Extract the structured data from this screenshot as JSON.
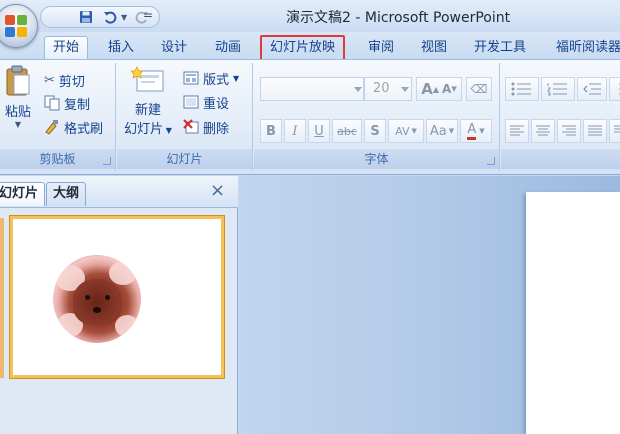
{
  "app": {
    "title": "演示文稿2 - Microsoft PowerPoint",
    "quick_access": {
      "save_icon": "save-icon",
      "undo_icon": "undo-icon",
      "redo_icon": "redo-icon",
      "customize_glyph": "="
    }
  },
  "tabs": [
    {
      "label": "开始",
      "active": true
    },
    {
      "label": "插入"
    },
    {
      "label": "设计"
    },
    {
      "label": "动画"
    },
    {
      "label": "幻灯片放映",
      "highlighted": true
    },
    {
      "label": "审阅"
    },
    {
      "label": "视图"
    },
    {
      "label": "开发工具"
    },
    {
      "label": "福昕阅读器"
    }
  ],
  "ribbon": {
    "clipboard": {
      "label": "剪贴板",
      "paste": "粘贴",
      "cut": "剪切",
      "copy": "复制",
      "format_painter": "格式刷"
    },
    "slides": {
      "label": "幻灯片",
      "new_slide_line1": "新建",
      "new_slide_line2": "幻灯片",
      "layout": "版式",
      "reset": "重设",
      "delete": "删除"
    },
    "font": {
      "label": "字体",
      "font_name": "",
      "font_size": "20",
      "bold": "B",
      "italic": "I",
      "underline": "U",
      "strike": "abc",
      "shadow": "S",
      "spacing": "AV",
      "change_case": "Aa",
      "font_color": "A",
      "grow": "A",
      "shrink": "A"
    }
  },
  "pane": {
    "tab_slides": "幻灯片",
    "tab_outline": "大纲",
    "close": "×"
  },
  "colors": {
    "accent_highlight": "#e03a3a",
    "selected_border": "#f5c25a"
  }
}
